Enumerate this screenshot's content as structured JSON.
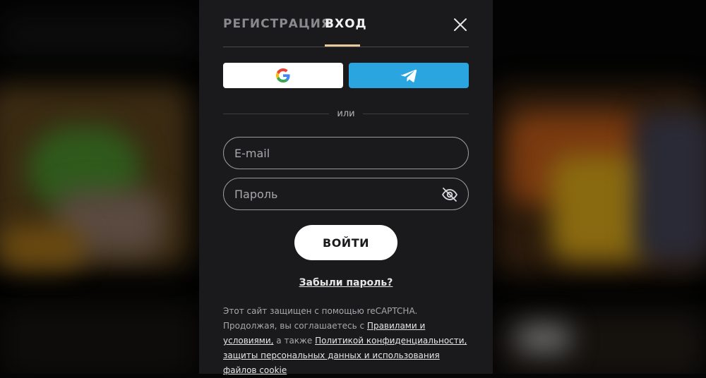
{
  "tabs": {
    "register_label": "РЕГИСТРАЦИЯ",
    "login_label": "ВХОД",
    "active": "login"
  },
  "social": {
    "google_icon": "google-icon",
    "telegram_icon": "telegram-icon",
    "telegram_color": "#2ba5e0"
  },
  "divider": {
    "label": "или"
  },
  "form": {
    "email_placeholder": "E-mail",
    "password_placeholder": "Пароль",
    "submit_label": "ВОЙТИ",
    "forgot_label": "Забыли пароль?"
  },
  "legal": {
    "text_1": "Этот сайт защищен с помощью reCAPTCHA. Продолжая, вы соглашаетесь с ",
    "terms_link": "Правилами и условиями,",
    "text_2": " а также ",
    "privacy_link": "Политикой конфиденциальности, защиты персональных данных и использования файлов cookie"
  },
  "colors": {
    "modal_bg": "#1a1a1c",
    "accent_underline": "#e8c99a"
  }
}
